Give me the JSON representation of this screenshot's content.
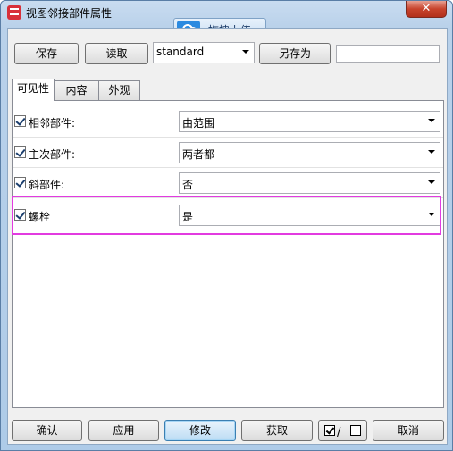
{
  "window": {
    "title": "视图邻接部件属性"
  },
  "drag_upload": {
    "label": "拖拽上传"
  },
  "toolbar": {
    "save_label": "保存",
    "load_label": "读取",
    "preset_value": "standard",
    "save_as_label": "另存为",
    "save_as_name": ""
  },
  "tabs": [
    {
      "label": "可见性",
      "active": true
    },
    {
      "label": "内容",
      "active": false
    },
    {
      "label": "外观",
      "active": false
    }
  ],
  "properties": [
    {
      "label": "相邻部件:",
      "checked": true,
      "value": "由范围"
    },
    {
      "label": "主次部件:",
      "checked": true,
      "value": "两者都"
    },
    {
      "label": "斜部件:",
      "checked": true,
      "value": "否"
    },
    {
      "label": "螺栓",
      "checked": true,
      "value": "是"
    }
  ],
  "footer": {
    "ok_label": "确认",
    "apply_label": "应用",
    "modify_label": "修改",
    "get_label": "获取",
    "toggle_slash": "/",
    "cancel_label": "取消"
  },
  "colors": {
    "highlight": "#e23be0",
    "accent": "#3c7fb1"
  },
  "icons": {
    "app": "app-logo-icon",
    "cloud": "cloud-upload-icon",
    "close": "close-icon"
  }
}
